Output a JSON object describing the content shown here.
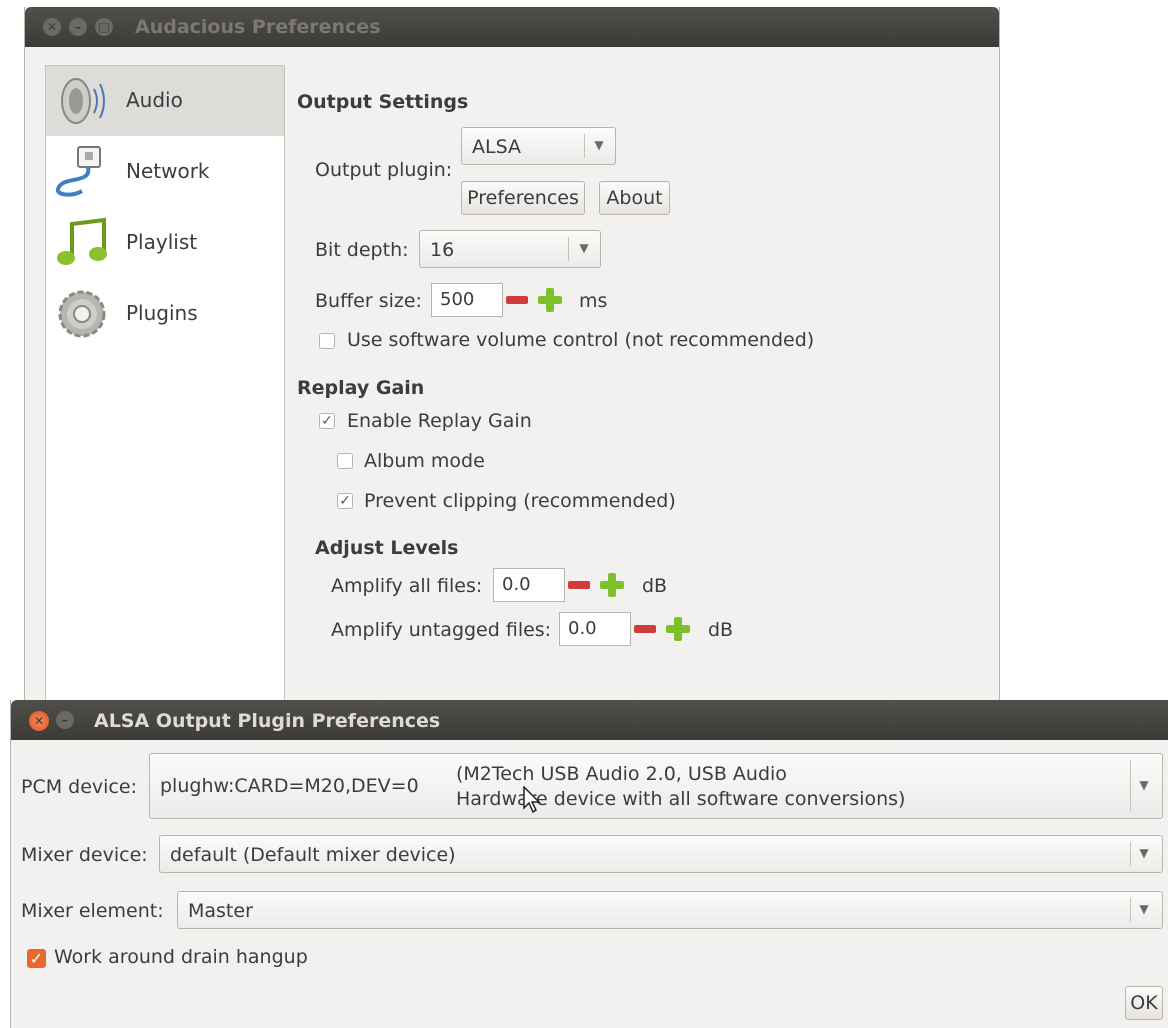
{
  "main_window": {
    "title": "Audacious Preferences",
    "sidebar": [
      {
        "label": "Audio",
        "icon": "speaker-icon",
        "selected": true
      },
      {
        "label": "Network",
        "icon": "network-cable-icon",
        "selected": false
      },
      {
        "label": "Playlist",
        "icon": "music-note-icon",
        "selected": false
      },
      {
        "label": "Plugins",
        "icon": "gear-icon",
        "selected": false
      }
    ],
    "output_settings": {
      "heading": "Output Settings",
      "output_plugin_label": "Output plugin:",
      "output_plugin_value": "ALSA",
      "preferences_button": "Preferences",
      "about_button": "About",
      "bit_depth_label": "Bit depth:",
      "bit_depth_value": "16",
      "buffer_size_label": "Buffer size:",
      "buffer_size_value": "500",
      "buffer_size_unit": "ms",
      "software_volume_label": "Use software volume control (not recommended)",
      "software_volume_checked": false
    },
    "replay_gain": {
      "heading": "Replay Gain",
      "enable_label": "Enable Replay Gain",
      "enable_checked": true,
      "album_mode_label": "Album mode",
      "album_mode_checked": false,
      "prevent_clipping_label": "Prevent clipping (recommended)",
      "prevent_clipping_checked": true
    },
    "adjust_levels": {
      "heading": "Adjust Levels",
      "amplify_all_label": "Amplify all files:",
      "amplify_all_value": "0.0",
      "amplify_all_unit": "dB",
      "amplify_untagged_label": "Amplify untagged files:",
      "amplify_untagged_value": "0.0",
      "amplify_untagged_unit": "dB"
    }
  },
  "alsa_window": {
    "title": "ALSA Output Plugin Preferences",
    "pcm_device_label": "PCM device:",
    "pcm_device_value": "plughw:CARD=M20,DEV=0",
    "pcm_device_desc_line1": "(M2Tech USB Audio 2.0, USB Audio",
    "pcm_device_desc_line2": "Hardware device with all software conversions)",
    "mixer_device_label": "Mixer device:",
    "mixer_device_value": "default  (Default mixer device)",
    "mixer_element_label": "Mixer element:",
    "mixer_element_value": "Master",
    "drain_hangup_label": "Work around drain hangup",
    "drain_hangup_checked": true,
    "ok_button": "OK"
  },
  "colors": {
    "titlebar": "#3c3b37",
    "window_bg": "#f2f1f0",
    "accent_orange": "#e8692e",
    "minus_red": "#d23b3b",
    "plus_green": "#7fbf2a"
  }
}
